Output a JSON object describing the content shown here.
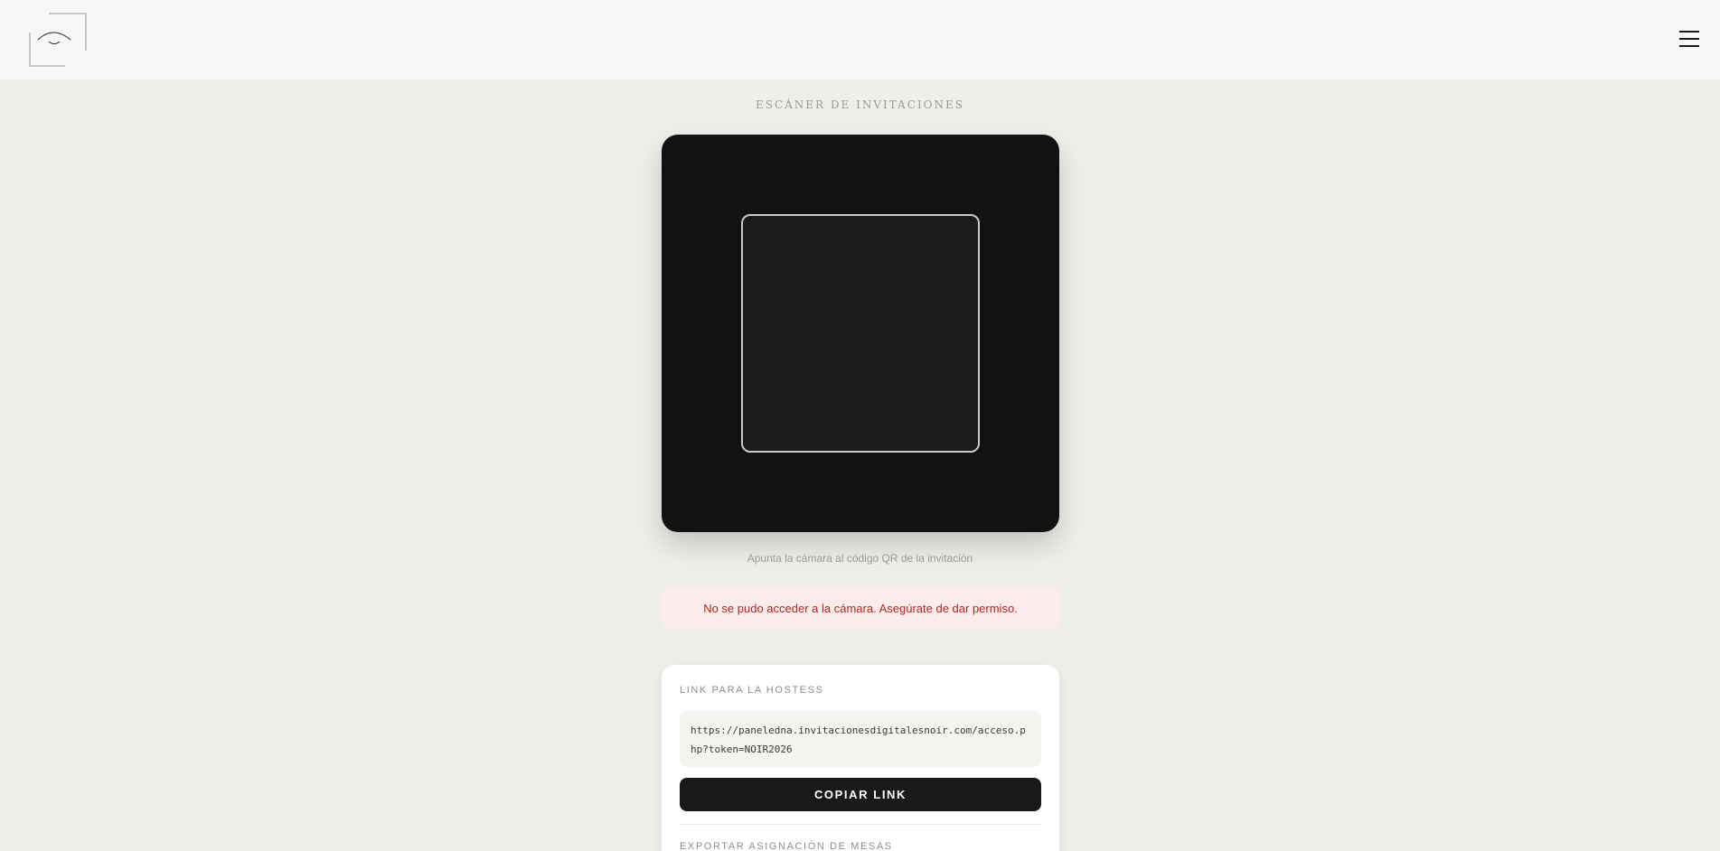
{
  "header": {
    "logo_icon": "eye-frame-logo",
    "menu_icon": "hamburger-menu-icon"
  },
  "page": {
    "title": "ESCÁNER DE INVITACIONES",
    "hint": "Apunta la cámara al código QR de la invitación",
    "error": "No se pudo acceder a la cámara. Asegúrate de dar permiso."
  },
  "hostess_card": {
    "label": "LINK PARA LA HOSTESS",
    "link": "https://paneledna.invitacionesdigitalesnoir.com/acceso.php?token=NOIR2026",
    "copy_button": "COPIAR LINK",
    "export_label": "EXPORTAR ASIGNACIÓN DE MESAS"
  },
  "colors": {
    "background": "#efeeea",
    "scanner": "#121212",
    "error_text": "#b3261e",
    "error_bg": "#fdeceb",
    "button": "#1a1a1a"
  }
}
